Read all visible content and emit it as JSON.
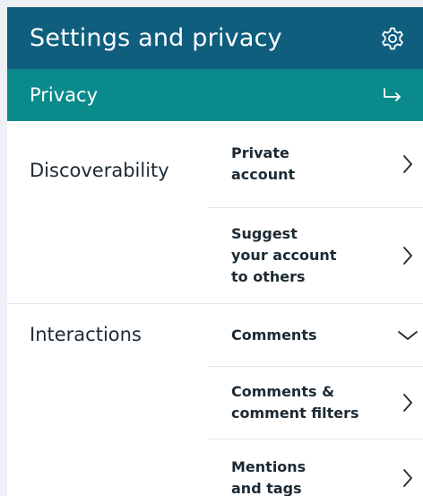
{
  "header": {
    "title": "Settings and privacy",
    "settings_icon": "gear-icon"
  },
  "subheader": {
    "title": "Privacy",
    "back_icon": "return-arrow-icon"
  },
  "sections": [
    {
      "label": "Discoverability",
      "items": [
        {
          "line1": "Private",
          "line2": "account",
          "state": "collapsed"
        },
        {
          "line1": "Suggest",
          "line2": "your account",
          "line3": "to others",
          "state": "collapsed"
        }
      ]
    },
    {
      "label": "Interactions",
      "items": [
        {
          "line1": "Comments",
          "state": "expanded"
        },
        {
          "line1": "Comments &",
          "line2": "comment filters",
          "state": "collapsed"
        },
        {
          "line1": "Mentions",
          "line2": "and tags",
          "state": "collapsed"
        }
      ]
    }
  ],
  "colors": {
    "header_bg": "#0f5e7e",
    "subheader_bg": "#0a8a8a",
    "panel_bg": "#ffffff",
    "page_bg": "#edf1f5",
    "text": "#1d2a33",
    "divider": "#e3e6e9"
  }
}
